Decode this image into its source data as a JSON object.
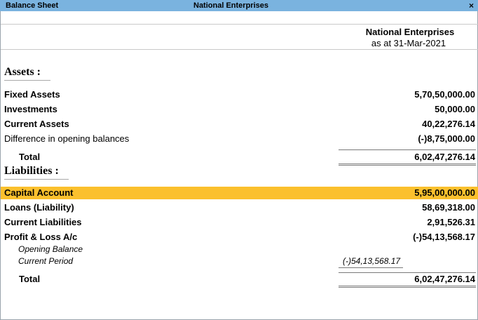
{
  "titlebar": {
    "left_title": "Balance Sheet",
    "center_title": "National Enterprises",
    "close_glyph": "×"
  },
  "header": {
    "company": "National Enterprises",
    "as_at": "as at 31-Mar-2021"
  },
  "assets": {
    "heading": "Assets :",
    "rows": [
      {
        "label": "Fixed Assets",
        "amount": "5,70,50,000.00"
      },
      {
        "label": "Investments",
        "amount": "50,000.00"
      },
      {
        "label": "Current Assets",
        "amount": "40,22,276.14"
      },
      {
        "label": "Difference in opening balances",
        "amount": "(-)8,75,000.00"
      }
    ],
    "total_label": "Total",
    "total_amount": "6,02,47,276.14"
  },
  "liabilities": {
    "heading": "Liabilities :",
    "rows": [
      {
        "label": "Capital Account",
        "amount": "5,95,00,000.00"
      },
      {
        "label": "Loans (Liability)",
        "amount": "58,69,318.00"
      },
      {
        "label": "Current Liabilities",
        "amount": "2,91,526.31"
      },
      {
        "label": "Profit & Loss A/c",
        "amount": "(-)54,13,568.17"
      }
    ],
    "sub_rows": [
      {
        "label": "Opening Balance",
        "amount": ""
      },
      {
        "label": "Current Period",
        "amount": "(-)54,13,568.17"
      }
    ],
    "total_label": "Total",
    "total_amount": "6,02,47,276.14"
  },
  "colors": {
    "titlebar": "#7ab3df",
    "highlight": "#fbc02d"
  }
}
